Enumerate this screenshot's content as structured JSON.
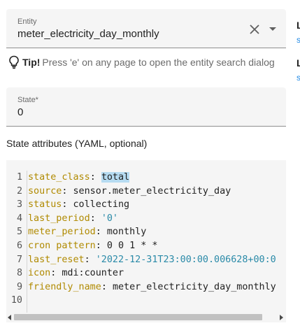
{
  "entity_field": {
    "label": "Entity",
    "value": "meter_electricity_day_monthly"
  },
  "tip": {
    "bold": "Tip!",
    "text": "Press 'e' on any page to open the entity search dialog"
  },
  "state_field": {
    "label": "State*",
    "value": "0"
  },
  "attributes_heading": "State attributes (YAML, optional)",
  "editor": {
    "line_numbers": [
      "1",
      "2",
      "3",
      "4",
      "5",
      "6",
      "7",
      "8",
      "9",
      "10"
    ],
    "lines": [
      {
        "key": "state_class",
        "sep": ": ",
        "value": "total",
        "value_kind": "highlight"
      },
      {
        "key": "source",
        "sep": ": ",
        "value": "sensor.meter_electricity_day",
        "value_kind": "plain"
      },
      {
        "key": "status",
        "sep": ": ",
        "value": "collecting",
        "value_kind": "plain"
      },
      {
        "key": "last_period",
        "sep": ": ",
        "value": "'0'",
        "value_kind": "string"
      },
      {
        "key": "meter_period",
        "sep": ": ",
        "value": "monthly",
        "value_kind": "plain"
      },
      {
        "key": "cron pattern",
        "sep": ": ",
        "value": "0 0 1 * *",
        "value_kind": "plain"
      },
      {
        "key": "last_reset",
        "sep": ": ",
        "value": "'2022-12-31T23:00:00.006628+00:0",
        "value_kind": "string"
      },
      {
        "key": "icon",
        "sep": ": ",
        "value": "mdi:counter",
        "value_kind": "plain"
      },
      {
        "key": "friendly_name",
        "sep": ": ",
        "value": "meter_electricity_day_monthly",
        "value_kind": "plain"
      },
      {
        "key": "",
        "sep": "",
        "value": "",
        "value_kind": "plain"
      }
    ]
  },
  "right_column": {
    "items": [
      {
        "heading": "L",
        "link": "s"
      },
      {
        "heading": "L",
        "link": "s"
      }
    ]
  },
  "colors": {
    "field_bg": "#f5f5f5",
    "yaml_key": "#b08a00",
    "yaml_string": "#2a8aa8",
    "selection": "#b6dbf1",
    "link": "#1e88e5"
  }
}
